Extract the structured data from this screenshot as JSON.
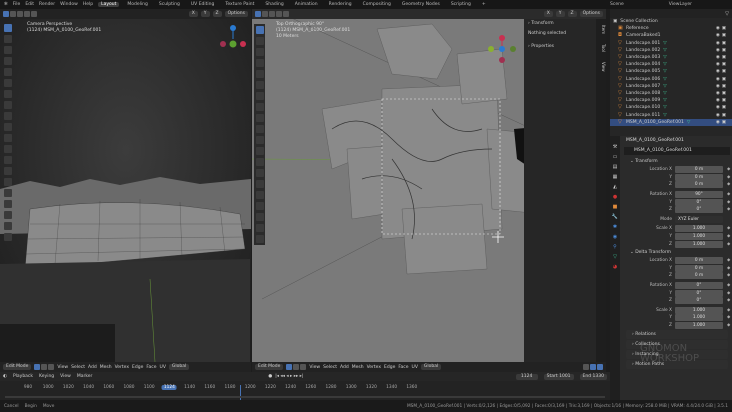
{
  "menu": [
    "File",
    "Edit",
    "Render",
    "Window",
    "Help"
  ],
  "workspaces": [
    "Layout",
    "Modeling",
    "Sculpting",
    "UV Editing",
    "Texture Paint",
    "Shading",
    "Animation",
    "Rendering",
    "Compositing",
    "Geometry Nodes",
    "Scripting",
    "+"
  ],
  "scene": {
    "scene_name": "Scene",
    "view_layer": "ViewLayer"
  },
  "left_viewport": {
    "view_name": "Camera Perspective",
    "object": "(1124) MSM_A_0100_GeoRef.001",
    "options": "Options",
    "axes": [
      "X",
      "Y",
      "Z"
    ],
    "mode": "Edit Mode",
    "menus": [
      "View",
      "Select",
      "Add",
      "Mesh",
      "Vertex",
      "Edge",
      "Face",
      "UV"
    ],
    "transform": "Global"
  },
  "right_viewport": {
    "view_name": "Top Orthographic 90°",
    "object": "(1124) MSM_A_0100_GeoRef.001",
    "scale": "10 Meters",
    "options": "Options",
    "axes": [
      "X",
      "Y",
      "Z"
    ],
    "mode": "Edit Mode",
    "menus": [
      "View",
      "Select",
      "Add",
      "Mesh",
      "Vertex",
      "Edge",
      "Face",
      "UV"
    ],
    "transform": "Global",
    "sidebar": {
      "transform": "Transform",
      "nothing": "Nothing selected",
      "properties": "Properties",
      "tabs": [
        "Item",
        "Tool",
        "View"
      ]
    }
  },
  "outliner": {
    "root": "Scene Collection",
    "items": [
      {
        "name": "Reference",
        "type": "collection"
      },
      {
        "name": "CameraBaked1",
        "type": "camera"
      },
      {
        "name": "Landscape.001",
        "type": "mesh"
      },
      {
        "name": "Landscape.002",
        "type": "mesh"
      },
      {
        "name": "Landscape.003",
        "type": "mesh"
      },
      {
        "name": "Landscape.004",
        "type": "mesh"
      },
      {
        "name": "Landscape.005",
        "type": "mesh"
      },
      {
        "name": "Landscape.006",
        "type": "mesh"
      },
      {
        "name": "Landscape.007",
        "type": "mesh"
      },
      {
        "name": "Landscape.008",
        "type": "mesh"
      },
      {
        "name": "Landscape.009",
        "type": "mesh"
      },
      {
        "name": "Landscape.010",
        "type": "mesh"
      },
      {
        "name": "Landscape.011",
        "type": "mesh"
      },
      {
        "name": "MSM_A_0100_GeoRef.001",
        "type": "mesh",
        "selected": true
      }
    ]
  },
  "properties": {
    "object_name": "MSM_A_0100_GeoRef.001",
    "datablock": "MSM_A_0100_GeoRef.001",
    "transform": {
      "title": "Transform",
      "location": [
        "0 m",
        "0 m",
        "0 m"
      ],
      "rotation": [
        "90°",
        "0°",
        "0°"
      ],
      "mode_label": "Mode",
      "mode": "XYZ Euler",
      "scale": [
        "1.000",
        "1.000",
        "1.000"
      ]
    },
    "delta": {
      "title": "Delta Transform",
      "location": [
        "0 m",
        "0 m",
        "0 m"
      ],
      "rotation": [
        "0°",
        "0°",
        "0°"
      ],
      "scale": [
        "1.000",
        "1.000",
        "1.000"
      ]
    },
    "labels": {
      "location_x": "Location X",
      "rotation_x": "Rotation X",
      "scale_x": "Scale X",
      "y": "Y",
      "z": "Z"
    },
    "collapsed": [
      "Relations",
      "Collections",
      "Instancing",
      "Motion Paths"
    ]
  },
  "timeline": {
    "menus": [
      "Playback",
      "Keying",
      "View",
      "Marker"
    ],
    "current_frame": "1124",
    "start": "Start",
    "start_val": "1001",
    "end": "End",
    "end_val": "1330",
    "ticks": [
      "980",
      "1000",
      "1020",
      "1040",
      "1060",
      "1080",
      "1100",
      "1124",
      "1140",
      "1160",
      "1180",
      "1200",
      "1220",
      "1240",
      "1260",
      "1280",
      "1300",
      "1320",
      "1340",
      "1360"
    ]
  },
  "statusbar": {
    "hints": [
      "Cancel",
      "Begin",
      "Move"
    ],
    "stats": "MSM_A_0100_GeoRef.001 | Verts:0/2,126 | Edges:0/5,092 | Faces:0/3,169 | Tris:3,169 | Objects:1/16 | Memory: 258.0 MiB | VRAM: 4.4/24.0 GiB | 3.5.1"
  },
  "watermark": "GNOMON WORKSHOP"
}
